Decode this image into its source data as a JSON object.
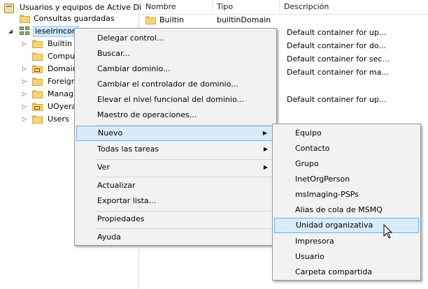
{
  "tree": {
    "root": "Usuarios y equipos de Active Dir",
    "saved": "Consultas guardadas",
    "domain": "ieselrincon",
    "children": [
      "Builtin",
      "Compu",
      "Domain",
      "Foreign",
      "Manag",
      "UOyera",
      "Users"
    ]
  },
  "list": {
    "columns": [
      "Nombre",
      "Tipo",
      "Descripción"
    ],
    "rows": [
      {
        "name": "Builtin",
        "type": "builtinDomain",
        "desc": ""
      },
      {
        "name": "",
        "type": "",
        "desc": "Default container for up..."
      },
      {
        "name": "",
        "type": "",
        "desc": "Default container for do..."
      },
      {
        "name": "",
        "type": "",
        "desc": "Default container for sec..."
      },
      {
        "name": "",
        "type": "",
        "desc": "Default container for ma..."
      },
      {
        "name": "",
        "type": "",
        "desc": ""
      },
      {
        "name": "",
        "type": "",
        "desc": "Default container for up..."
      }
    ]
  },
  "context_menu": {
    "items": [
      "Delegar control...",
      "Buscar...",
      "Cambiar dominio...",
      "Cambiar el controlador de dominio...",
      "Elevar el nivel funcional del dominio...",
      "Maestro de operaciones...",
      "Nuevo",
      "Todas las tareas",
      "Ver",
      "Actualizar",
      "Exportar lista...",
      "Propiedades",
      "Ayuda"
    ]
  },
  "submenu": {
    "items": [
      "Equipo",
      "Contacto",
      "Grupo",
      "InetOrgPerson",
      "msImaging-PSPs",
      "Alias de cola de MSMQ",
      "Unidad organizativa",
      "Impresora",
      "Usuario",
      "Carpeta compartida"
    ]
  },
  "colors": {
    "highlight_bg": "#d8ebf9",
    "highlight_border": "#6fb0e5",
    "menu_bg": "#f2f2f2"
  }
}
